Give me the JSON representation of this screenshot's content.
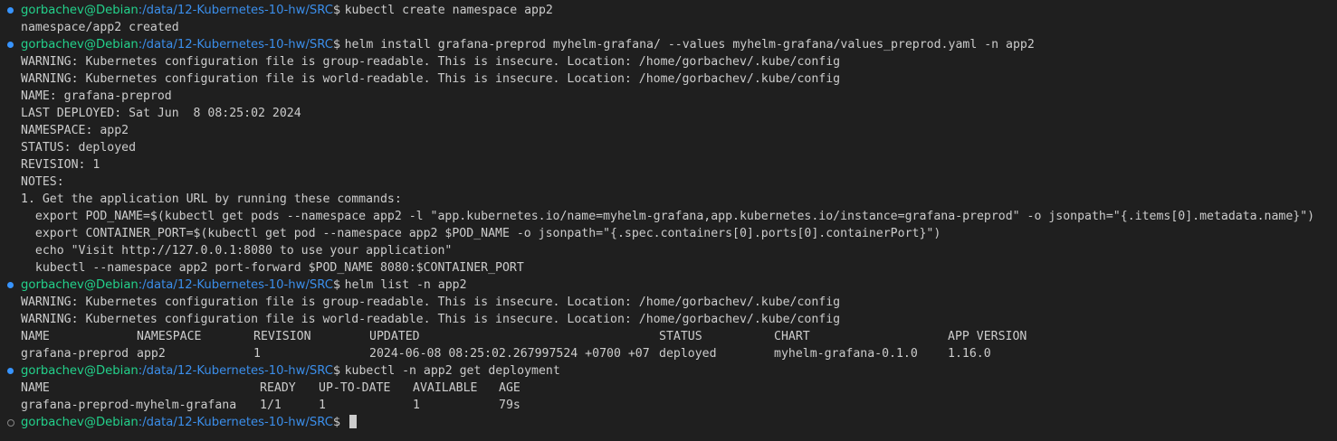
{
  "prompt": {
    "user": "gorbachev@Debian",
    "path": ":/data/12-Kubernetes-10-hw/SRC",
    "symbol": "$"
  },
  "lines": [
    {
      "cmd": "kubectl create namespace app2"
    },
    {
      "out": "namespace/app2 created"
    },
    {
      "cmd": "helm install grafana-preprod myhelm-grafana/ --values myhelm-grafana/values_preprod.yaml -n app2"
    },
    {
      "out": "WARNING: Kubernetes configuration file is group-readable. This is insecure. Location: /home/gorbachev/.kube/config"
    },
    {
      "out": "WARNING: Kubernetes configuration file is world-readable. This is insecure. Location: /home/gorbachev/.kube/config"
    },
    {
      "out": "NAME: grafana-preprod"
    },
    {
      "out": "LAST DEPLOYED: Sat Jun  8 08:25:02 2024"
    },
    {
      "out": "NAMESPACE: app2"
    },
    {
      "out": "STATUS: deployed"
    },
    {
      "out": "REVISION: 1"
    },
    {
      "out": "NOTES:"
    },
    {
      "out": "1. Get the application URL by running these commands:"
    },
    {
      "out": "  export POD_NAME=$(kubectl get pods --namespace app2 -l \"app.kubernetes.io/name=myhelm-grafana,app.kubernetes.io/instance=grafana-preprod\" -o jsonpath=\"{.items[0].metadata.name}\")"
    },
    {
      "out": "  export CONTAINER_PORT=$(kubectl get pod --namespace app2 $POD_NAME -o jsonpath=\"{.spec.containers[0].ports[0].containerPort}\")"
    },
    {
      "out": "  echo \"Visit http://127.0.0.1:8080 to use your application\""
    },
    {
      "out": "  kubectl --namespace app2 port-forward $POD_NAME 8080:$CONTAINER_PORT"
    },
    {
      "cmd": "helm list -n app2"
    },
    {
      "out": "WARNING: Kubernetes configuration file is group-readable. This is insecure. Location: /home/gorbachev/.kube/config"
    },
    {
      "out": "WARNING: Kubernetes configuration file is world-readable. This is insecure. Location: /home/gorbachev/.kube/config"
    },
    {
      "cells": [
        "NAME",
        "NAMESPACE",
        "REVISION",
        "UPDATED",
        "STATUS",
        "CHART",
        "APP VERSION"
      ]
    },
    {
      "cells": [
        "grafana-preprod",
        "app2",
        "1",
        "2024-06-08 08:25:02.267997524 +0700 +07",
        "deployed",
        "myhelm-grafana-0.1.0",
        "1.16.0"
      ]
    },
    {
      "cmd": "kubectl -n app2 get deployment"
    },
    {
      "cells2": [
        "NAME",
        "READY",
        "UP-TO-DATE",
        "AVAILABLE",
        "AGE"
      ]
    },
    {
      "cells2": [
        "grafana-preprod-myhelm-grafana",
        "1/1",
        "1",
        "1",
        "79s"
      ]
    },
    {
      "cmd": "",
      "active": true
    }
  ]
}
